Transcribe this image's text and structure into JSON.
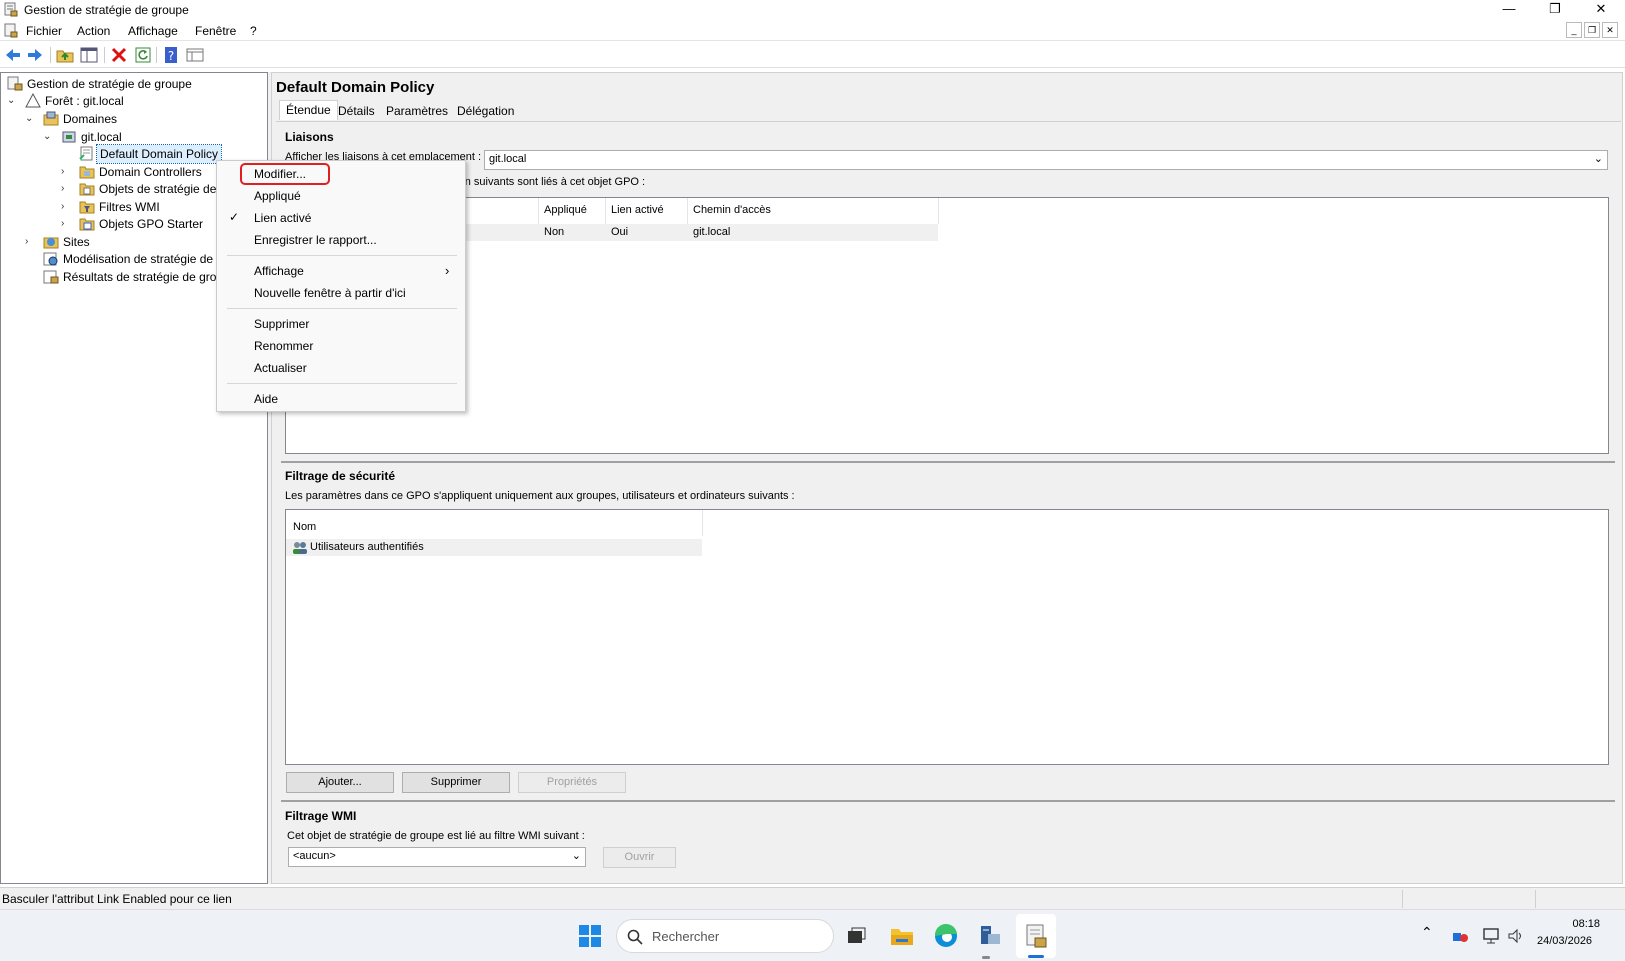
{
  "window": {
    "title": "Gestion de stratégie de groupe",
    "controls": [
      "minimize-icon",
      "restore-icon",
      "close-icon"
    ]
  },
  "menubar": {
    "items": [
      "Fichier",
      "Action",
      "Affichage",
      "Fenêtre",
      "?"
    ]
  },
  "toolbar": {
    "icons": [
      "back-arrow-icon",
      "forward-arrow-icon",
      "up-folder-icon",
      "show-tree-icon",
      "delete-icon",
      "refresh-icon",
      "help-icon",
      "console-icon"
    ]
  },
  "tree": {
    "root": "Gestion de stratégie de groupe",
    "forest": "Forêt : git.local",
    "domains": "Domaines",
    "domain": "git.local",
    "selected": "Default Domain Policy",
    "children": [
      "Domain Controllers",
      "Objets de stratégie de",
      "Filtres WMI",
      "Objets GPO Starter"
    ],
    "sites": "Sites",
    "modeling": "Modélisation de stratégie de",
    "results": "Résultats de stratégie de grou"
  },
  "details": {
    "title": "Default Domain Policy",
    "tabs": [
      "Étendue",
      "Détails",
      "Paramètres",
      "Délégation"
    ],
    "active_tab": "Étendue",
    "links": {
      "heading": "Liaisons",
      "show_label": "Afficher les liaisons à cet emplacement :",
      "location_value": "git.local",
      "description_partial": "ation suivants sont liés à cet objet GPO :",
      "columns": [
        "Appliqué",
        "Lien activé",
        "Chemin d'accès"
      ],
      "rows": [
        {
          "applique": "Non",
          "lien_active": "Oui",
          "chemin": "git.local"
        }
      ]
    },
    "security": {
      "heading": "Filtrage de sécurité",
      "description": "Les paramètres dans ce GPO s'appliquent uniquement aux groupes, utilisateurs et ordinateurs suivants :",
      "column": "Nom",
      "rows": [
        "Utilisateurs authentifiés"
      ],
      "buttons": {
        "add": "Ajouter...",
        "remove": "Supprimer",
        "properties": "Propriétés"
      }
    },
    "wmi": {
      "heading": "Filtrage WMI",
      "description": "Cet objet de stratégie de groupe est lié au filtre WMI suivant :",
      "value": "<aucun>",
      "open_button": "Ouvrir"
    }
  },
  "context_menu": {
    "items": {
      "modifier": "Modifier...",
      "applique": "Appliqué",
      "lien_active": "Lien activé",
      "enregistrer": "Enregistrer le rapport...",
      "affichage": "Affichage",
      "nouvelle_fenetre": "Nouvelle fenêtre à partir d'ici",
      "supprimer": "Supprimer",
      "renommer": "Renommer",
      "actualiser": "Actualiser",
      "aide": "Aide"
    },
    "checked": "Lien activé",
    "highlighted": "Modifier...",
    "highlight_color": "#e02020"
  },
  "statusbar": {
    "text": "Basculer l'attribut Link Enabled pour ce lien"
  },
  "taskbar": {
    "search_placeholder": "Rechercher",
    "time": "08:18",
    "date": "24/03/2026",
    "icons": [
      "windows-start-icon",
      "search-icon",
      "task-view-icon",
      "file-explorer-icon",
      "edge-icon",
      "server-manager-icon",
      "gpmc-icon",
      "chevron-up-icon",
      "network-icon",
      "display-icon",
      "volume-icon"
    ]
  }
}
